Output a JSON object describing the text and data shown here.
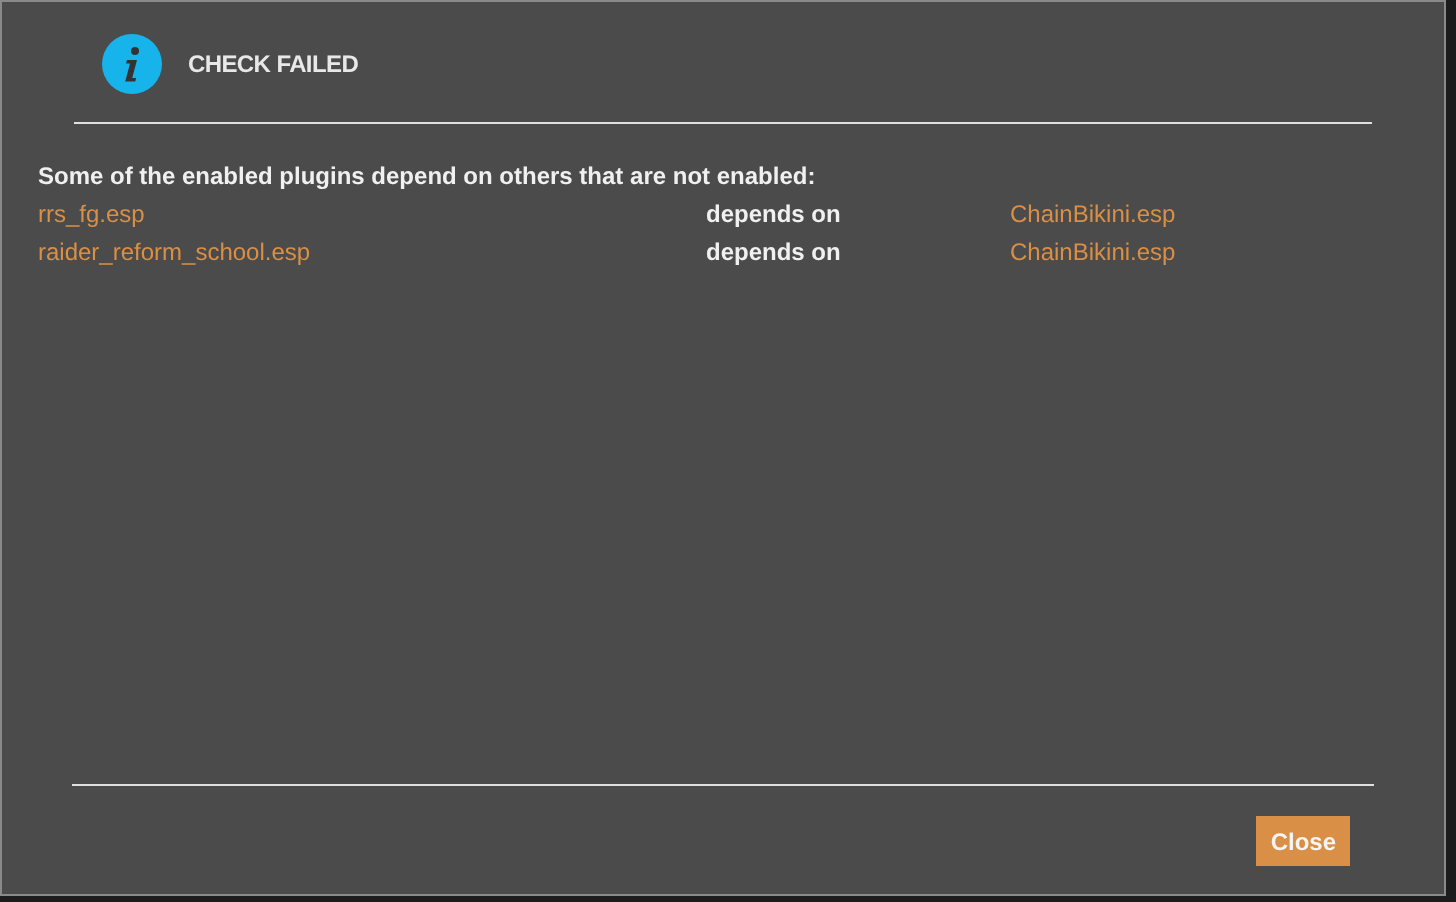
{
  "dialog": {
    "title": "CHECK FAILED",
    "message": "Some of the enabled plugins depend on others that are not enabled:",
    "rows": [
      {
        "plugin": "rrs_fg.esp",
        "relation": "depends on",
        "dependency": "ChainBikini.esp"
      },
      {
        "plugin": "raider_reform_school.esp",
        "relation": "depends on",
        "dependency": "ChainBikini.esp"
      }
    ],
    "buttons": [
      "Close"
    ]
  }
}
